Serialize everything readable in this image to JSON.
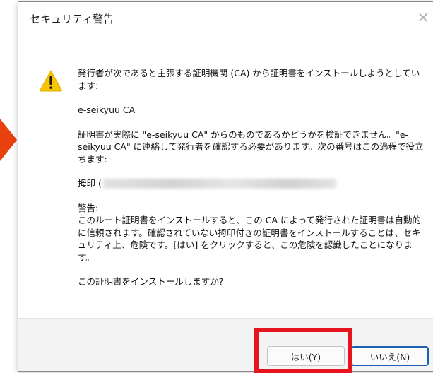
{
  "window": {
    "title": "セキュリティ警告",
    "close_glyph": "✕"
  },
  "message": {
    "intro": "発行者が次であると主張する証明機関 (CA) から証明書をインストールしようとしています:",
    "issuer_name": "e-seikyuu CA",
    "verify": "証明書が実際に \"e-seikyuu CA\" からのものであるかどうかを検証できません。\"e-seikyuu CA\" に連絡して発行者を確認する必要があります。次の番号はこの過程で役立ちます:",
    "thumbprint_label": "拇印 (",
    "warning_heading": "警告:",
    "warning_body": "このルート証明書をインストールすると、この CA によって発行された証明書は自動的に信頼されます。確認されていない拇印付きの証明書をインストールすることは、セキュリティ上、危険です。[はい] をクリックすると、この危険を認識したことになります。",
    "question": "この証明書をインストールしますか?"
  },
  "buttons": {
    "yes": "はい(Y)",
    "no": "いいえ(N)"
  },
  "colors": {
    "highlight": "#e6141e",
    "arrow": "#e8410d",
    "warning_icon": "#f7c500",
    "default_button_border": "#1f5fb0"
  },
  "icons": {
    "warning": "warning-icon",
    "close": "close-icon"
  }
}
